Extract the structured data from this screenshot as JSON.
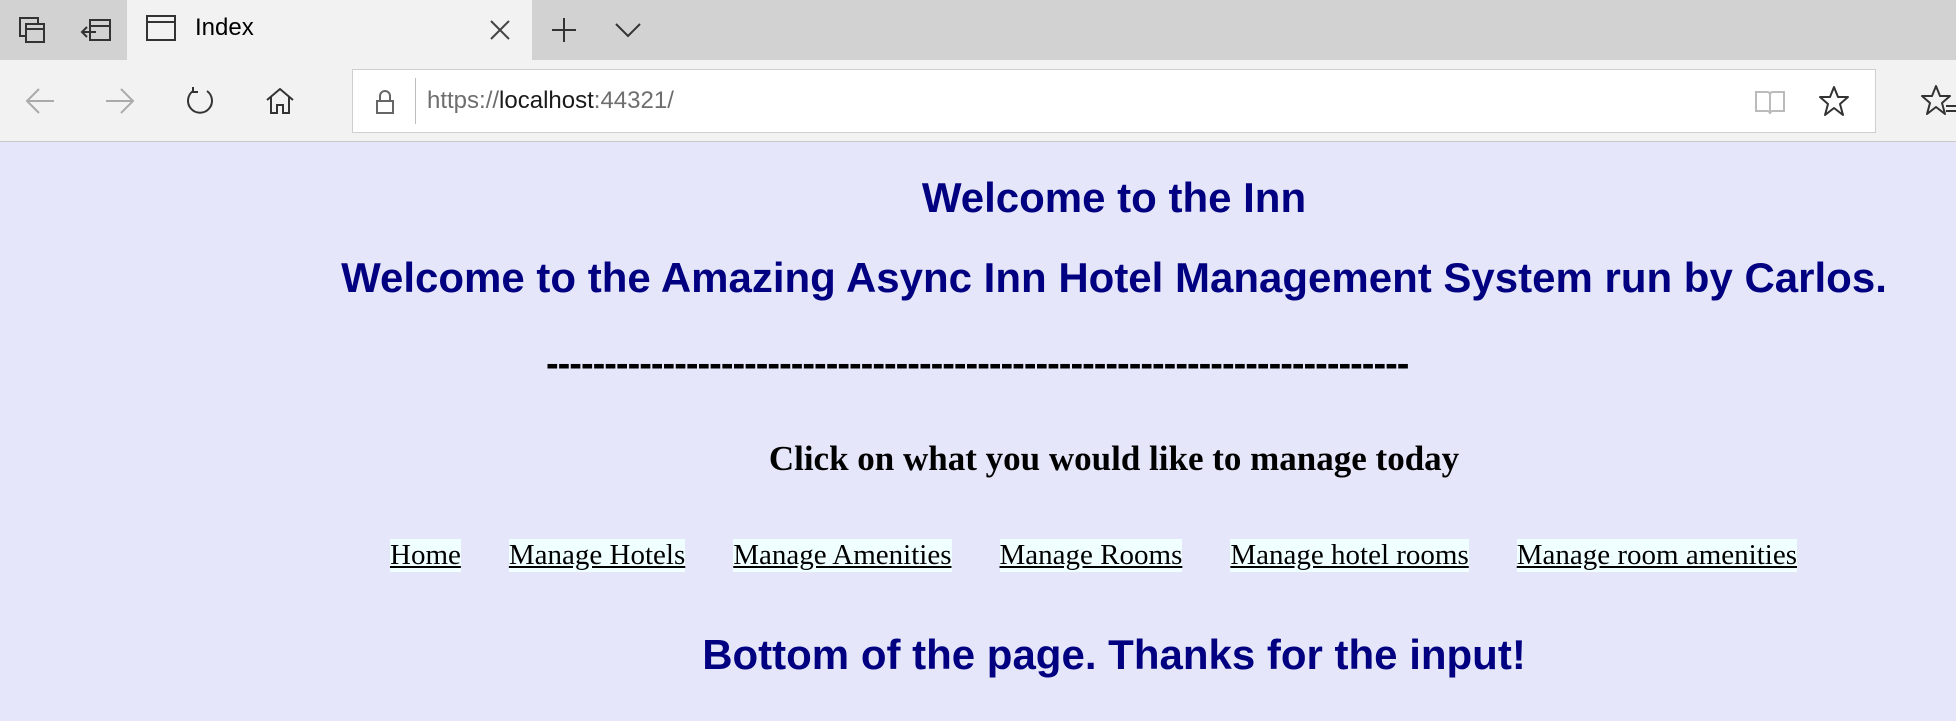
{
  "browser": {
    "tab": {
      "title": "Index"
    },
    "address": {
      "scheme": "https://",
      "host": "localhost",
      "port_path": ":44321/"
    }
  },
  "page": {
    "welcome": "Welcome to the Inn",
    "system": "Welcome to the Amazing Async Inn Hotel Management System run by Carlos.",
    "divider": "--------------------------------------------------------------------------",
    "prompt": "Click on what you would like to manage today",
    "links": [
      "Home",
      "Manage Hotels",
      "Manage Amenities",
      "Manage Rooms",
      "Manage hotel rooms",
      "Manage room amenities"
    ],
    "bottom": "Bottom of the page. Thanks for the input!"
  },
  "colors": {
    "page_background": "#e6e6fa",
    "heading": "#000080",
    "link_background": "#f0ffff"
  },
  "icons": {
    "tab_strip": [
      "tab-preview-icon",
      "set-aside-tabs-icon"
    ],
    "tab": "window-icon",
    "tab_close": "close-icon",
    "new_tab": "plus-icon",
    "tab_menu": "chevron-down-icon",
    "nav": [
      "back-arrow-icon",
      "forward-arrow-icon",
      "refresh-icon",
      "home-icon"
    ],
    "address": [
      "lock-icon",
      "reading-view-icon",
      "star-icon"
    ],
    "favorites_hub": "favorites-hub-icon"
  }
}
